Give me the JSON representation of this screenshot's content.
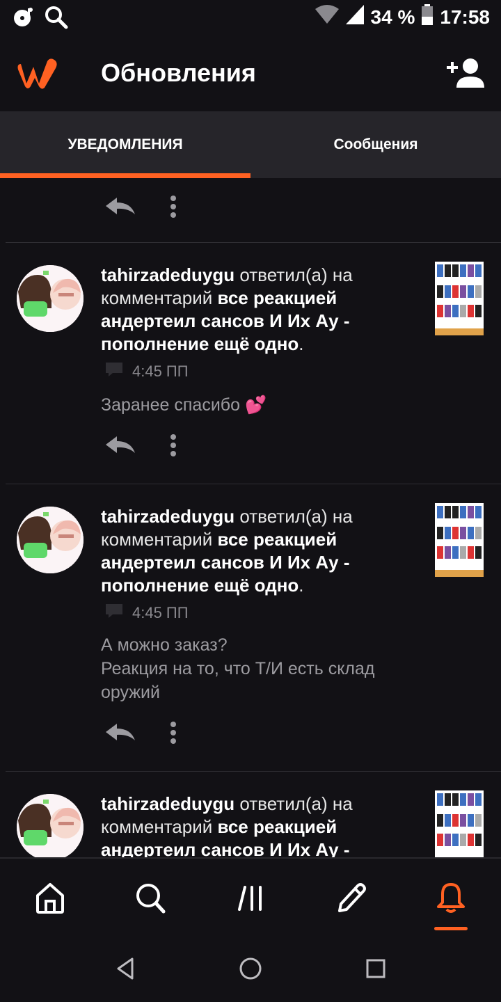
{
  "status_bar": {
    "battery": "34 %",
    "time": "17:58",
    "icons": [
      "media-icon",
      "search-icon",
      "wifi-icon",
      "signal-icon",
      "battery-icon"
    ]
  },
  "header": {
    "title": "Обновления",
    "logo": "wattpad-logo",
    "action_icon": "add-user-icon"
  },
  "tabs": [
    {
      "label": "УВЕДОМЛЕНИЯ",
      "active": true
    },
    {
      "label": "Сообщения",
      "active": false
    }
  ],
  "accent_color": "#ff6122",
  "notifications": [
    {
      "user": "tahirzadeduygu",
      "action": "ответил(а) на комментарий",
      "story": "все реакцией андертеил сансов И Их Ау - пополнение ещё одно",
      "time": "4:45 ПП",
      "message": "Заранее спасибо 💕"
    },
    {
      "user": "tahirzadeduygu",
      "action": "ответил(а) на комментарий",
      "story": "все реакцией андертеил сансов И Их Ау - пополнение ещё одно",
      "time": "4:45 ПП",
      "message": "А можно заказ?\nРеакция на то, что Т/И есть склад оружий"
    },
    {
      "user": "tahirzadeduygu",
      "action": "ответил(а) на",
      "action2": "комментарий",
      "story": "все реакцией андертеил сансов И Их Ау -"
    }
  ],
  "bottom_nav": [
    "home-icon",
    "search-icon",
    "library-icon",
    "write-icon",
    "notifications-icon"
  ],
  "system_nav": [
    "back-icon",
    "home-circle-icon",
    "recents-icon"
  ]
}
